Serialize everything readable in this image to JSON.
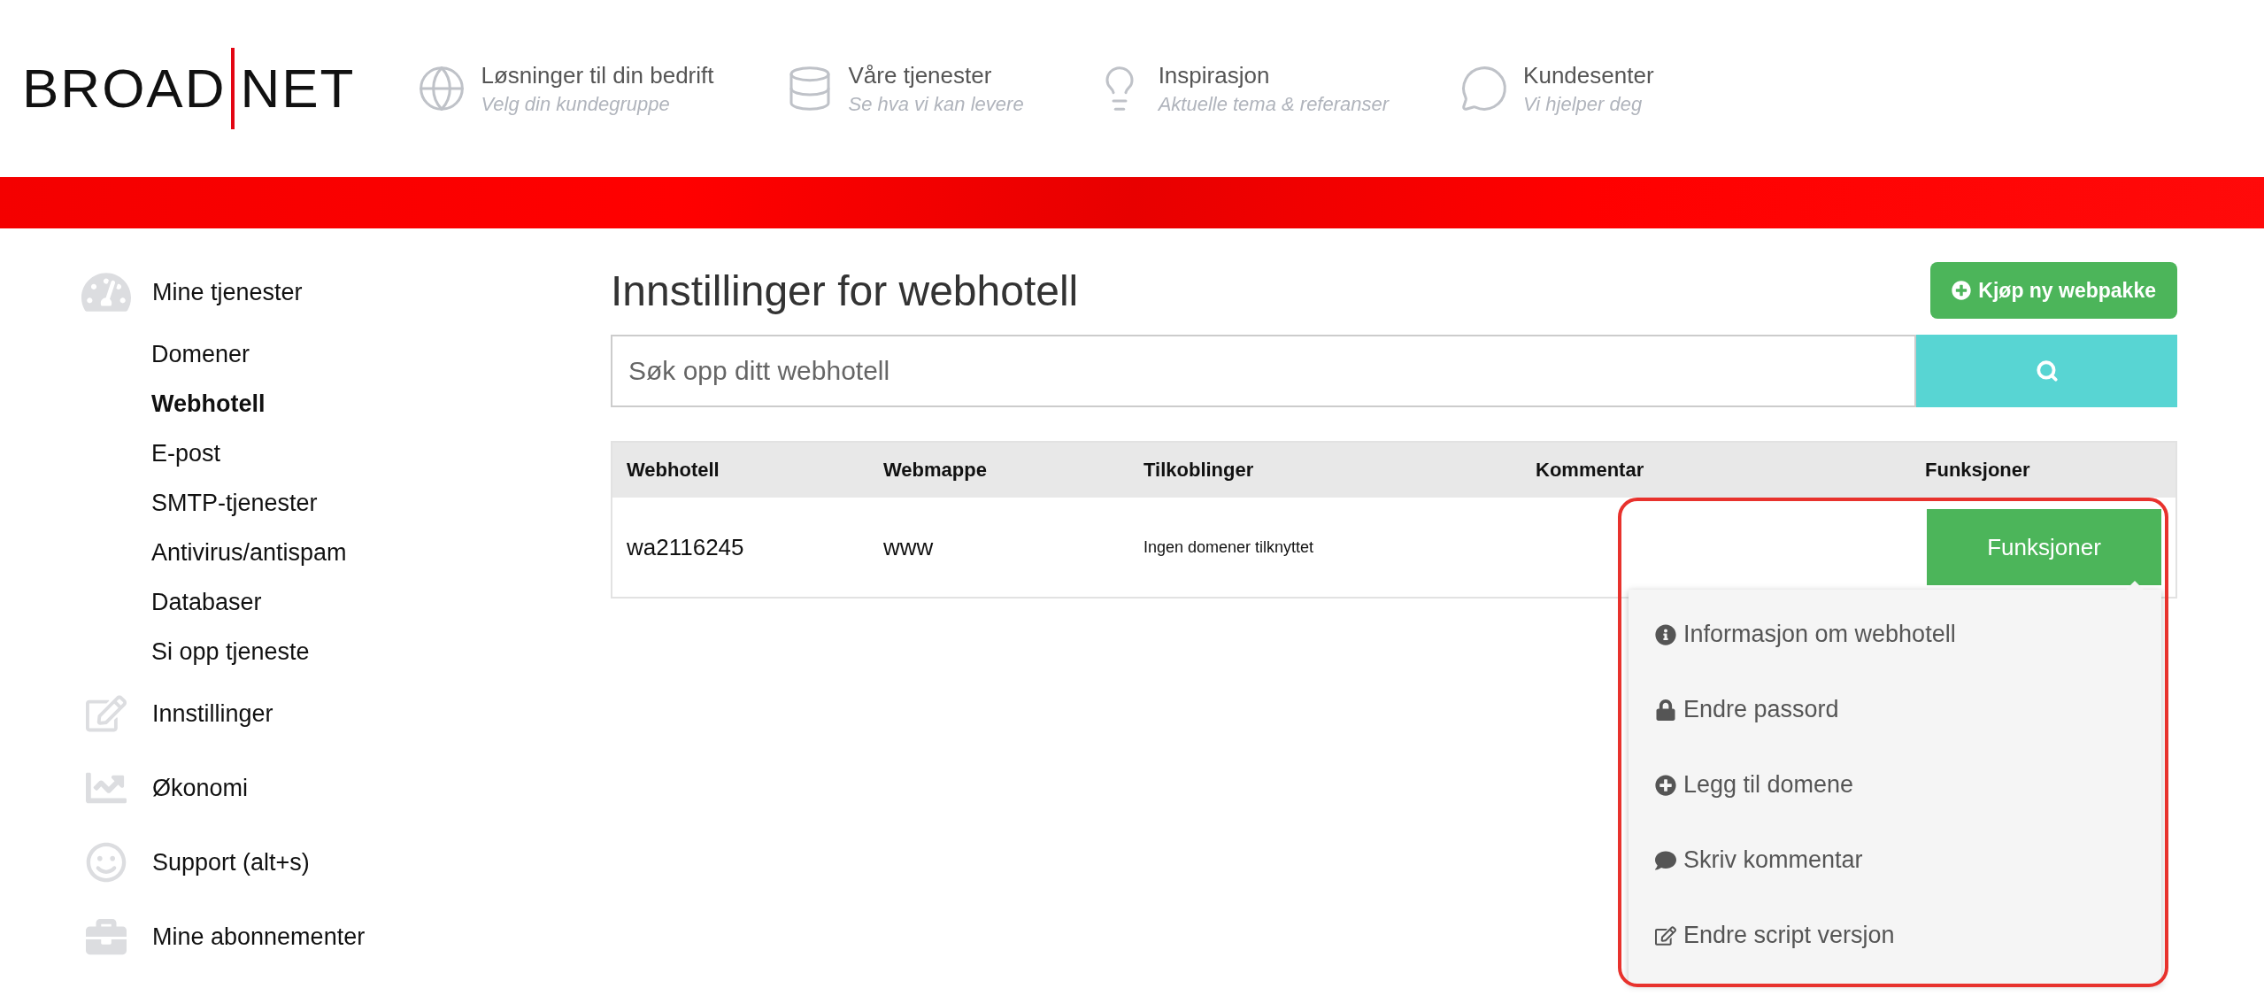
{
  "logo": {
    "left": "BROAD",
    "right": "NET"
  },
  "nav": [
    {
      "title": "Løsninger til din bedrift",
      "subtitle": "Velg din kundegruppe"
    },
    {
      "title": "Våre tjenester",
      "subtitle": "Se hva vi kan levere"
    },
    {
      "title": "Inspirasjon",
      "subtitle": "Aktuelle tema & referanser"
    },
    {
      "title": "Kundesenter",
      "subtitle": "Vi hjelper deg"
    }
  ],
  "sidebar": {
    "items": [
      {
        "label": "Mine tjenester",
        "selected": false,
        "children": [
          {
            "label": "Domener",
            "selected": false
          },
          {
            "label": "Webhotell",
            "selected": true
          },
          {
            "label": "E-post",
            "selected": false
          },
          {
            "label": "SMTP-tjenester",
            "selected": false
          },
          {
            "label": "Antivirus/antispam",
            "selected": false
          },
          {
            "label": "Databaser",
            "selected": false
          },
          {
            "label": "Si opp tjeneste",
            "selected": false
          }
        ]
      },
      {
        "label": "Innstillinger",
        "selected": false
      },
      {
        "label": "Økonomi",
        "selected": false
      },
      {
        "label": "Support (alt+s)",
        "selected": false
      },
      {
        "label": "Mine abonnementer",
        "selected": false
      }
    ]
  },
  "page": {
    "title": "Innstillinger for webhotell",
    "buy_button": "Kjøp ny webpakke",
    "search": {
      "placeholder": "Søk opp ditt webhotell"
    }
  },
  "table": {
    "columns": [
      "Webhotell",
      "Webmappe",
      "Tilkoblinger",
      "Kommentar",
      "Funksjoner"
    ],
    "rows": [
      {
        "webhotell": "wa2116245",
        "webmappe": "www",
        "tilkoblinger": "Ingen domener tilknyttet",
        "kommentar": "",
        "button": "Funksjoner"
      }
    ]
  },
  "dropdown": {
    "expanded": true,
    "items": [
      "Informasjon om webhotell",
      "Endre passord",
      "Legg til domene",
      "Skriv kommentar",
      "Endre script versjon"
    ]
  }
}
